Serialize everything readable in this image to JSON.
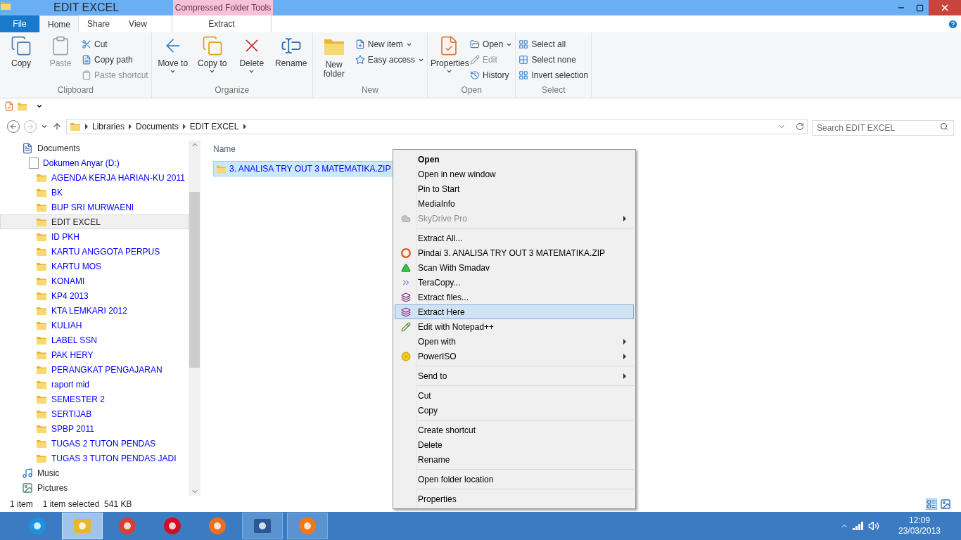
{
  "window": {
    "title": "EDIT EXCEL",
    "context_tab_group": "Compressed Folder Tools"
  },
  "tabs": [
    {
      "label": "File",
      "kind": "file",
      "selected": false
    },
    {
      "label": "Home",
      "kind": "tab",
      "selected": true
    },
    {
      "label": "Share",
      "kind": "tab",
      "selected": false
    },
    {
      "label": "View",
      "kind": "tab",
      "selected": false
    },
    {
      "label": "Extract",
      "kind": "context",
      "selected": false
    }
  ],
  "ribbon": [
    {
      "group": "Clipboard",
      "buttons": [
        {
          "label": "Copy",
          "kind": "large",
          "disabled": false,
          "dropdown": false
        },
        {
          "label": "Paste",
          "kind": "large",
          "disabled": true,
          "dropdown": false
        },
        {
          "kind": "stack",
          "items": [
            {
              "label": "Cut",
              "disabled": false,
              "dropdown": false
            },
            {
              "label": "Copy path",
              "disabled": false,
              "dropdown": false
            },
            {
              "label": "Paste shortcut",
              "disabled": true,
              "dropdown": false
            }
          ]
        }
      ]
    },
    {
      "group": "Organize",
      "buttons": [
        {
          "label": "Move to",
          "kind": "large",
          "disabled": false,
          "dropdown": true
        },
        {
          "label": "Copy to",
          "kind": "large",
          "disabled": false,
          "dropdown": true
        },
        {
          "label": "Delete",
          "kind": "large",
          "disabled": false,
          "dropdown": true
        },
        {
          "label": "Rename",
          "kind": "large",
          "disabled": false,
          "dropdown": false
        }
      ]
    },
    {
      "group": "New",
      "buttons": [
        {
          "label": "New folder",
          "kind": "large",
          "disabled": false,
          "dropdown": false
        },
        {
          "kind": "stack",
          "items": [
            {
              "label": "New item",
              "disabled": false,
              "dropdown": true
            },
            {
              "label": "Easy access",
              "disabled": false,
              "dropdown": true
            }
          ]
        }
      ]
    },
    {
      "group": "Open",
      "buttons": [
        {
          "label": "Properties",
          "kind": "large",
          "disabled": false,
          "dropdown": true
        },
        {
          "kind": "stack",
          "items": [
            {
              "label": "Open",
              "disabled": false,
              "dropdown": true
            },
            {
              "label": "Edit",
              "disabled": true,
              "dropdown": false
            },
            {
              "label": "History",
              "disabled": false,
              "dropdown": false
            }
          ]
        }
      ]
    },
    {
      "group": "Select",
      "buttons": [
        {
          "kind": "stack",
          "items": [
            {
              "label": "Select all",
              "disabled": false,
              "dropdown": false
            },
            {
              "label": "Select none",
              "disabled": false,
              "dropdown": false
            },
            {
              "label": "Invert selection",
              "disabled": false,
              "dropdown": false
            }
          ]
        }
      ]
    }
  ],
  "address": {
    "crumbs": [
      "Libraries",
      "Documents",
      "EDIT EXCEL"
    ],
    "search_placeholder": "Search EDIT EXCEL"
  },
  "sidebar": {
    "items": [
      {
        "label": "Documents",
        "kind": "library",
        "compressed": false,
        "selected": false,
        "children": [
          {
            "label": "Dokumen Anyar (D:)",
            "kind": "drive",
            "compressed": true,
            "selected": false,
            "children": [
              {
                "label": "AGENDA KERJA HARIAN-KU 2011",
                "kind": "folder",
                "compressed": true,
                "selected": false
              },
              {
                "label": "BK",
                "kind": "folder",
                "compressed": true,
                "selected": false
              },
              {
                "label": "BUP SRI MURWAENI",
                "kind": "folder",
                "compressed": true,
                "selected": false
              },
              {
                "label": "EDIT EXCEL",
                "kind": "folder",
                "compressed": false,
                "selected": true
              },
              {
                "label": "ID PKH",
                "kind": "folder",
                "compressed": true,
                "selected": false
              },
              {
                "label": "KARTU ANGGOTA PERPUS",
                "kind": "folder",
                "compressed": true,
                "selected": false
              },
              {
                "label": "KARTU MOS",
                "kind": "folder",
                "compressed": true,
                "selected": false
              },
              {
                "label": "KONAMI",
                "kind": "folder",
                "compressed": true,
                "selected": false
              },
              {
                "label": "KP4 2013",
                "kind": "folder",
                "compressed": true,
                "selected": false
              },
              {
                "label": "KTA LEMKARI  2012",
                "kind": "folder",
                "compressed": true,
                "selected": false
              },
              {
                "label": "KULIAH",
                "kind": "folder",
                "compressed": true,
                "selected": false
              },
              {
                "label": "LABEL SSN",
                "kind": "folder",
                "compressed": true,
                "selected": false
              },
              {
                "label": "PAK HERY",
                "kind": "folder",
                "compressed": true,
                "selected": false
              },
              {
                "label": "PERANGKAT PENGAJARAN",
                "kind": "folder",
                "compressed": true,
                "selected": false
              },
              {
                "label": "raport mid",
                "kind": "folder",
                "compressed": true,
                "selected": false
              },
              {
                "label": "SEMESTER 2",
                "kind": "folder",
                "compressed": true,
                "selected": false
              },
              {
                "label": "SERTIJAB",
                "kind": "folder",
                "compressed": true,
                "selected": false
              },
              {
                "label": "SPBP 2011",
                "kind": "folder",
                "compressed": true,
                "selected": false
              },
              {
                "label": "TUGAS 2 TUTON PENDAS",
                "kind": "folder",
                "compressed": true,
                "selected": false
              },
              {
                "label": "TUGAS 3 TUTON PENDAS JADI",
                "kind": "folder",
                "compressed": true,
                "selected": false
              }
            ]
          }
        ]
      },
      {
        "label": "Music",
        "kind": "music",
        "compressed": false,
        "selected": false
      },
      {
        "label": "Pictures",
        "kind": "pictures",
        "compressed": false,
        "selected": false
      }
    ]
  },
  "file_list": {
    "columns": [
      "Name"
    ],
    "rows": [
      {
        "name": "3. ANALISA TRY OUT 3 MATEMATIKA.ZIP",
        "selected": true
      }
    ]
  },
  "context_menu": {
    "sections": [
      [
        {
          "label": "Open",
          "default": true,
          "disabled": false,
          "submenu": false,
          "selected": false
        },
        {
          "label": "Open in new window",
          "default": false,
          "disabled": false,
          "submenu": false,
          "selected": false
        },
        {
          "label": "Pin to Start",
          "default": false,
          "disabled": false,
          "submenu": false,
          "selected": false
        },
        {
          "label": "MediaInfo",
          "default": false,
          "disabled": false,
          "submenu": false,
          "selected": false
        },
        {
          "label": "SkyDrive Pro",
          "default": false,
          "disabled": true,
          "submenu": true,
          "selected": false
        }
      ],
      [
        {
          "label": "Extract All...",
          "default": false,
          "disabled": false,
          "submenu": false,
          "selected": false
        },
        {
          "label": "Pindai 3. ANALISA TRY OUT 3 MATEMATIKA.ZIP",
          "default": false,
          "disabled": false,
          "submenu": false,
          "selected": false
        },
        {
          "label": "Scan With Smadav",
          "default": false,
          "disabled": false,
          "submenu": false,
          "selected": false
        },
        {
          "label": "TeraCopy...",
          "default": false,
          "disabled": false,
          "submenu": false,
          "selected": false
        },
        {
          "label": "Extract files...",
          "default": false,
          "disabled": false,
          "submenu": false,
          "selected": false
        },
        {
          "label": "Extract Here",
          "default": false,
          "disabled": false,
          "submenu": false,
          "selected": true
        },
        {
          "label": "Edit with Notepad++",
          "default": false,
          "disabled": false,
          "submenu": false,
          "selected": false
        },
        {
          "label": "Open with",
          "default": false,
          "disabled": false,
          "submenu": true,
          "selected": false
        },
        {
          "label": "PowerISO",
          "default": false,
          "disabled": false,
          "submenu": true,
          "selected": false
        }
      ],
      [
        {
          "label": "Send to",
          "default": false,
          "disabled": false,
          "submenu": true,
          "selected": false
        }
      ],
      [
        {
          "label": "Cut",
          "default": false,
          "disabled": false,
          "submenu": false,
          "selected": false
        },
        {
          "label": "Copy",
          "default": false,
          "disabled": false,
          "submenu": false,
          "selected": false
        }
      ],
      [
        {
          "label": "Create shortcut",
          "default": false,
          "disabled": false,
          "submenu": false,
          "selected": false
        },
        {
          "label": "Delete",
          "default": false,
          "disabled": false,
          "submenu": false,
          "selected": false
        },
        {
          "label": "Rename",
          "default": false,
          "disabled": false,
          "submenu": false,
          "selected": false
        }
      ],
      [
        {
          "label": "Open folder location",
          "default": false,
          "disabled": false,
          "submenu": false,
          "selected": false
        }
      ],
      [
        {
          "label": "Properties",
          "default": false,
          "disabled": false,
          "submenu": false,
          "selected": false
        }
      ]
    ]
  },
  "status_bar": {
    "count": "1 item",
    "selection": "1 item selected  541 KB"
  },
  "taskbar": {
    "apps": [
      {
        "kind": "ie",
        "active": false,
        "running": false
      },
      {
        "kind": "explorer",
        "active": true,
        "running": true
      },
      {
        "kind": "chrome",
        "active": false,
        "running": false
      },
      {
        "kind": "opera",
        "active": false,
        "running": false
      },
      {
        "kind": "firefox",
        "active": false,
        "running": false
      },
      {
        "kind": "word",
        "active": false,
        "running": true
      },
      {
        "kind": "avast",
        "active": false,
        "running": true
      }
    ],
    "time": "12:09",
    "date": "23/03/2013"
  }
}
